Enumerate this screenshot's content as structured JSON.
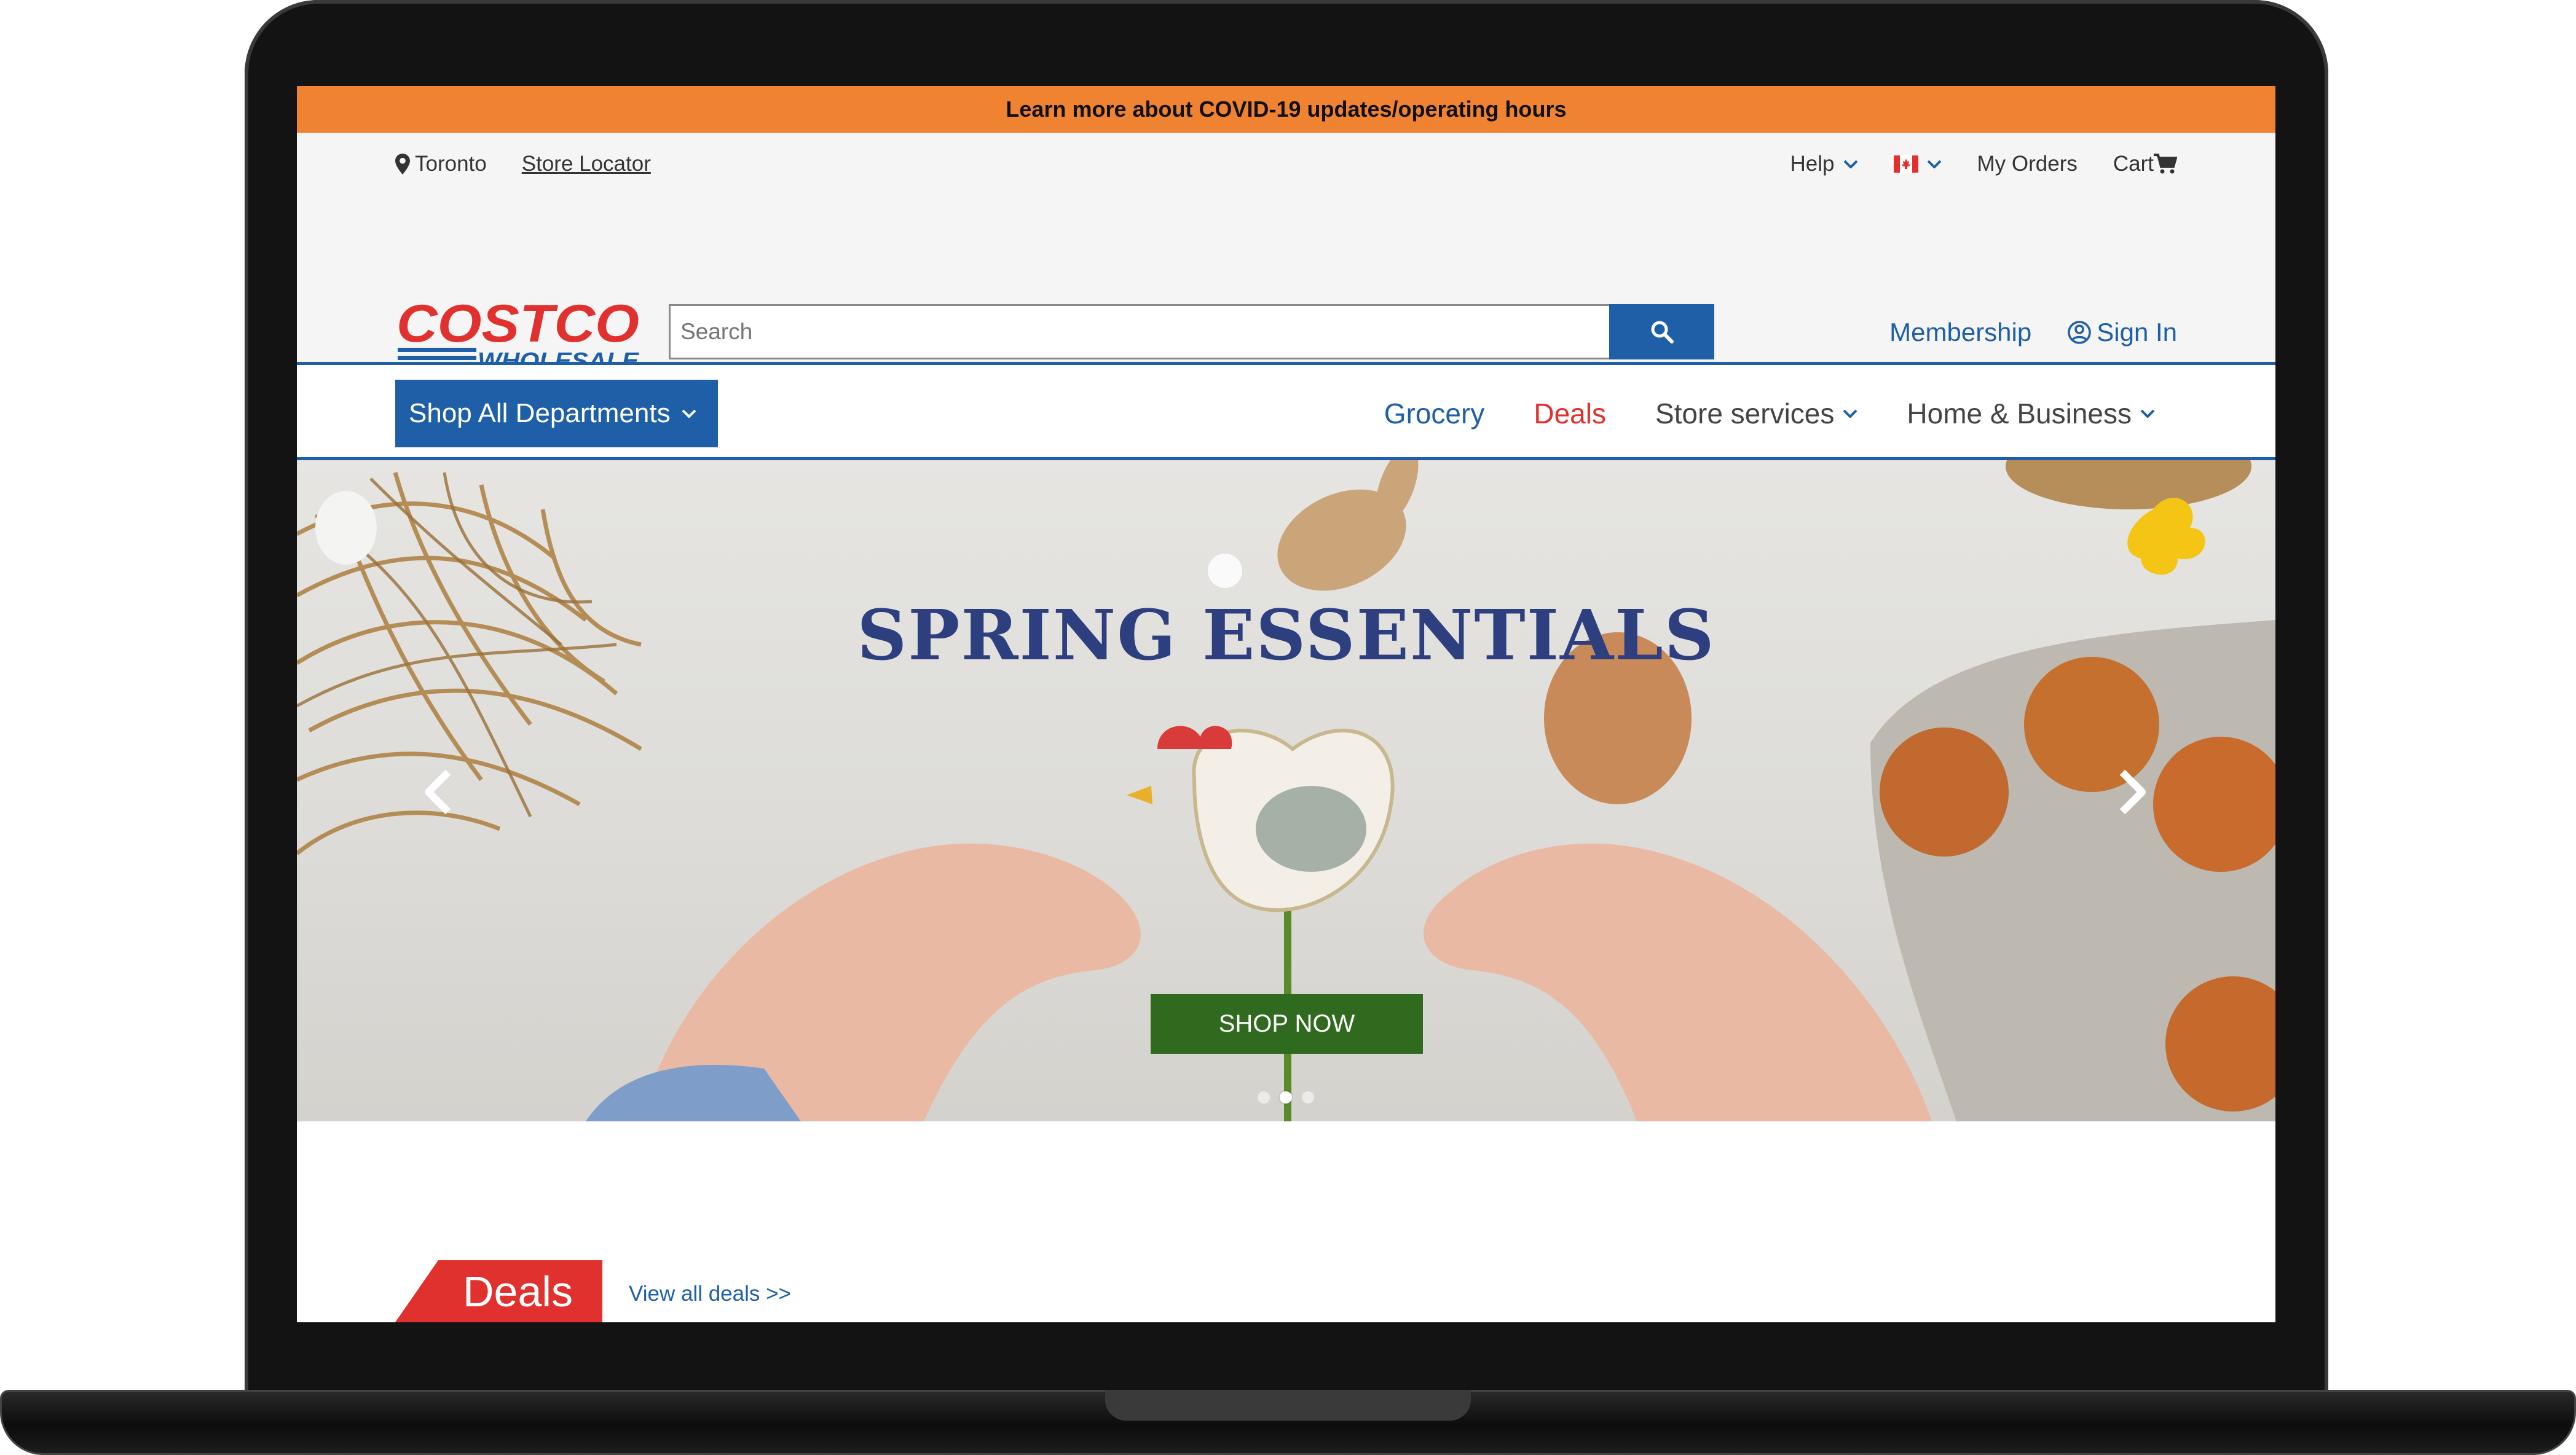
{
  "banner": {
    "text": "Learn more about COVID-19 updates/operating hours",
    "color": "#f08332"
  },
  "utility": {
    "location": "Toronto",
    "location_icon": "map-pin-icon",
    "store_locator": "Store Locator",
    "help": "Help",
    "country_icon": "canada-flag-icon",
    "my_orders": "My Orders",
    "cart": "Cart",
    "cart_icon": "shopping-cart-icon"
  },
  "header": {
    "logo_top": "COSTCO",
    "logo_bottom": "WHOLESALE",
    "search_placeholder": "Search",
    "search_icon": "search-icon",
    "membership": "Membership",
    "sign_in": "Sign In",
    "sign_in_icon": "user-circle-icon"
  },
  "nav": {
    "shop_all": "Shop All Departments",
    "links": [
      "Grocery",
      "Deals",
      "Store services",
      "Home & Business"
    ]
  },
  "hero": {
    "title": "SPRING ESSENTIALS",
    "cta": "SHOP NOW",
    "slides": 3,
    "active_slide": 2
  },
  "deals": {
    "label": "Deals",
    "view_all": "View all deals >>"
  },
  "colors": {
    "brand_blue": "#1f5fa7",
    "brand_red": "#e1312e",
    "cta_green": "#2f6a1f",
    "banner_orange": "#f08332"
  }
}
